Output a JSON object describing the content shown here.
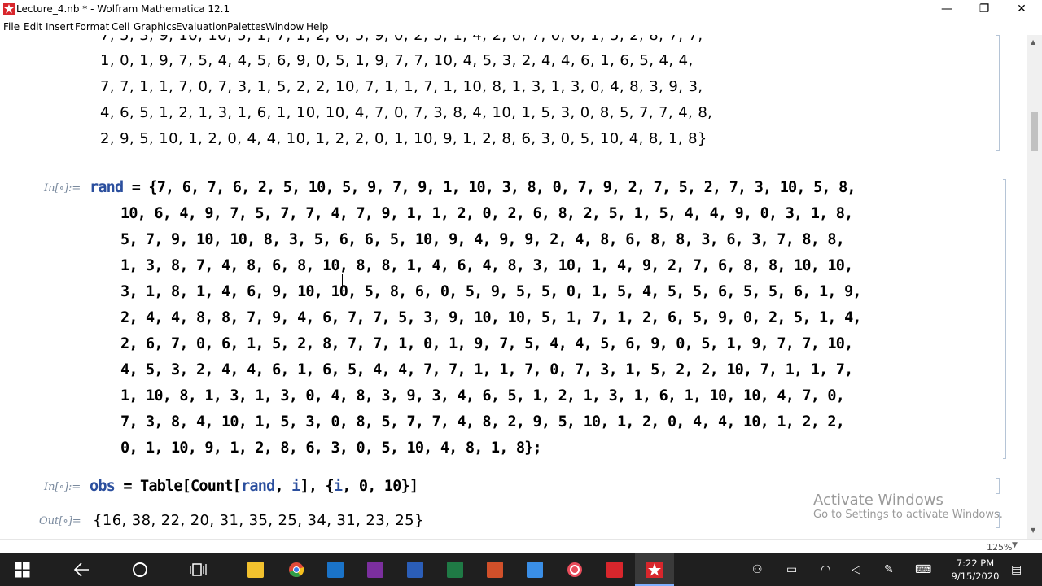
{
  "window": {
    "title": "Lecture_4.nb * - Wolfram Mathematica 12.1",
    "minimize": "—",
    "maximize": "❐",
    "close": "✕"
  },
  "menu": [
    "File",
    "Edit",
    "Insert",
    "Format",
    "Cell",
    "Graphics",
    "Evaluation",
    "Palettes",
    "Window",
    "Help"
  ],
  "notebook": {
    "prev_output_lines": [
      "7, 5, 3, 9, 10, 10, 5, 1, 7, 1, 2, 6, 5, 9, 0, 2, 5, 1, 4, 2, 6, 7, 0, 6, 1, 5, 2, 8, 7, 7,",
      "1, 0, 1, 9, 7, 5, 4, 4, 5, 6, 9, 0, 5, 1, 9, 7, 7, 10, 4, 5, 3, 2, 4, 4, 6, 1, 6, 5, 4, 4,",
      "7, 7, 1, 1, 7, 0, 7, 3, 1, 5, 2, 2, 10, 7, 1, 1, 7, 1, 10, 8, 1, 3, 1, 3, 0, 4, 8, 3, 9, 3,",
      "4, 6, 5, 1, 2, 1, 3, 1, 6, 1, 10, 10, 4, 7, 0, 7, 3, 8, 4, 10, 1, 5, 3, 0, 8, 5, 7, 7, 4, 8,",
      "2, 9, 5, 10, 1, 2, 0, 4, 4, 10, 1, 2, 2, 0, 1, 10, 9, 1, 2, 8, 6, 3, 0, 5, 10, 4, 8, 1, 8}"
    ],
    "in_label_1": "In[∘]:=",
    "rand_var": "rand",
    "rand_first": " = {7, 6, 7, 6, 2, 5, 10, 5, 9, 7, 9, 1, 10, 3, 8, 0, 7, 9, 2, 7, 5, 2, 7, 3, 10, 5, 8,",
    "rand_lines": [
      "10, 6, 4, 9, 7, 5, 7, 7, 4, 7, 9, 1, 1, 2, 0, 2, 6, 8, 2, 5, 1, 5, 4, 4, 9, 0, 3, 1, 8,",
      "5, 7, 9, 10, 10, 8, 3, 5, 6, 6, 5, 10, 9, 4, 9, 9, 2, 4, 8, 6, 8, 8, 3, 6, 3, 7, 8, 8,",
      "1, 3, 8, 7, 4, 8, 6, 8, 10, 8, 8, 1, 4, 6, 4, 8, 3, 10, 1, 4, 9, 2, 7, 6, 8, 8, 10, 10,",
      "3, 1, 8, 1, 4, 6, 9, 10, 10, 5, 8, 6, 0, 5, 9, 5, 5, 0, 1, 5, 4, 5, 5, 6, 5, 5, 6, 1, 9,",
      "2, 4, 4, 8, 8, 7, 9, 4, 6, 7, 7, 5, 3, 9, 10, 10, 5, 1, 7, 1, 2, 6, 5, 9, 0, 2, 5, 1, 4,",
      "2, 6, 7, 0, 6, 1, 5, 2, 8, 7, 7, 1, 0, 1, 9, 7, 5, 4, 4, 5, 6, 9, 0, 5, 1, 9, 7, 7, 10,",
      "4, 5, 3, 2, 4, 4, 6, 1, 6, 5, 4, 4, 7, 7, 1, 1, 7, 0, 7, 3, 1, 5, 2, 2, 10, 7, 1, 1, 7,",
      "1, 10, 8, 1, 3, 1, 3, 0, 4, 8, 3, 9, 3, 4, 6, 5, 1, 2, 1, 3, 1, 6, 1, 10, 10, 4, 7, 0,",
      "7, 3, 8, 4, 10, 1, 5, 3, 0, 8, 5, 7, 7, 4, 8, 2, 9, 5, 10, 1, 2, 0, 4, 4, 10, 1, 2, 2,",
      "0, 1, 10, 9, 1, 2, 8, 6, 3, 0, 5, 10, 4, 8, 1, 8};"
    ],
    "in_label_2": "In[∘]:=",
    "obs_var": "obs",
    "obs_eq": " = Table[Count[",
    "obs_rand": "rand",
    "obs_mid": ", ",
    "obs_i1": "i",
    "obs_mid2": "], {",
    "obs_i2": "i",
    "obs_end": ", 0, 10}]",
    "out_label": "Out[∘]=",
    "out_value": "{16, 38, 22, 20, 31, 35, 25, 34, 31, 23, 25}"
  },
  "status": {
    "zoom": "125%"
  },
  "watermark": {
    "title": "Activate Windows",
    "subtitle": "Go to Settings to activate Windows."
  },
  "clock": {
    "time": "7:22 PM",
    "date": "9/15/2020"
  },
  "taskbar_apps": [
    {
      "name": "windows-start-icon",
      "color": "#ffffff"
    },
    {
      "name": "back-icon",
      "color": "#ffffff"
    },
    {
      "name": "cortana-icon",
      "color": "#ffffff"
    },
    {
      "name": "task-view-icon",
      "color": "#ffffff"
    },
    {
      "name": "file-explorer-icon",
      "color": "#f2c12e"
    },
    {
      "name": "chrome-icon",
      "color": "#e04a3a"
    },
    {
      "name": "outlook-icon",
      "color": "#1a73c8"
    },
    {
      "name": "onenote-icon",
      "color": "#7b2f9e"
    },
    {
      "name": "word-icon",
      "color": "#2b5eb8"
    },
    {
      "name": "excel-icon",
      "color": "#1f7a45"
    },
    {
      "name": "powerpoint-icon",
      "color": "#d1502a"
    },
    {
      "name": "store-icon",
      "color": "#3a8ee6"
    },
    {
      "name": "app-circle-icon",
      "color": "#e84c5b"
    },
    {
      "name": "acrobat-icon",
      "color": "#d8262c"
    },
    {
      "name": "mathematica-icon",
      "color": "#d8262c"
    }
  ]
}
